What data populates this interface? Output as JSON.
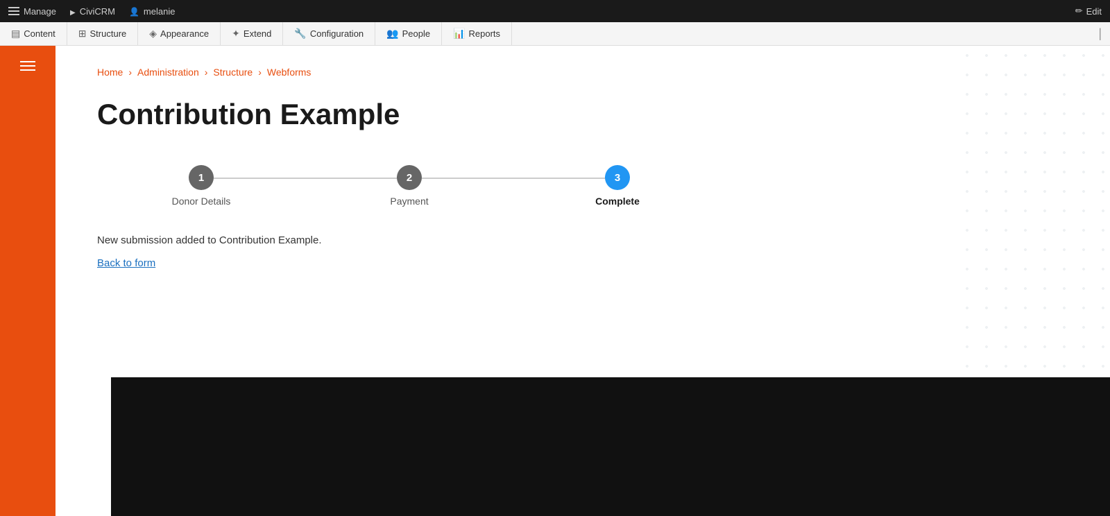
{
  "admin_bar": {
    "manage_label": "Manage",
    "civicrm_label": "CiviCRM",
    "user_label": "melanie",
    "edit_label": "Edit"
  },
  "nav": {
    "items": [
      {
        "id": "content",
        "label": "Content",
        "icon": "content-icon"
      },
      {
        "id": "structure",
        "label": "Structure",
        "icon": "structure-icon"
      },
      {
        "id": "appearance",
        "label": "Appearance",
        "icon": "appearance-icon"
      },
      {
        "id": "extend",
        "label": "Extend",
        "icon": "extend-icon"
      },
      {
        "id": "configuration",
        "label": "Configuration",
        "icon": "configuration-icon"
      },
      {
        "id": "people",
        "label": "People",
        "icon": "people-icon"
      },
      {
        "id": "reports",
        "label": "Reports",
        "icon": "reports-icon"
      }
    ]
  },
  "breadcrumb": {
    "items": [
      {
        "label": "Home",
        "href": "#"
      },
      {
        "label": "Administration",
        "href": "#"
      },
      {
        "label": "Structure",
        "href": "#"
      },
      {
        "label": "Webforms",
        "href": "#"
      }
    ]
  },
  "page": {
    "title": "Contribution Example",
    "submission_message": "New submission added to Contribution Example.",
    "back_link_label": "Back to form"
  },
  "steps": [
    {
      "number": "1",
      "label": "Donor Details",
      "active": false
    },
    {
      "number": "2",
      "label": "Payment",
      "active": false
    },
    {
      "number": "3",
      "label": "Complete",
      "active": true
    }
  ],
  "colors": {
    "accent": "#e84e0f",
    "active_step": "#2196f3",
    "inactive_step": "#666666"
  }
}
